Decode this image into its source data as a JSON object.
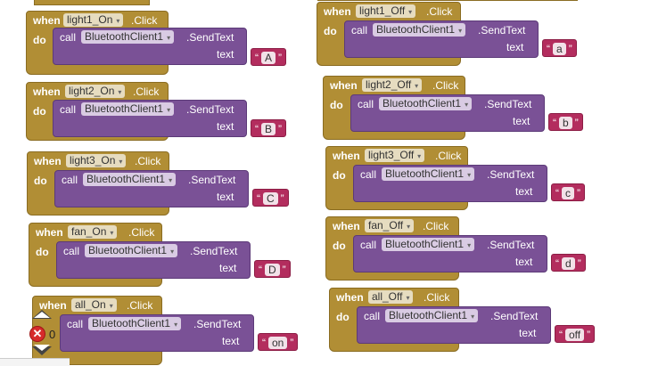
{
  "labels": {
    "when": "when",
    "do": "do",
    "call": "call",
    "text": "text",
    "click": ".Click",
    "send_text": ".SendText",
    "component": "BluetoothClient1"
  },
  "left_blocks": [
    {
      "event": "light1_On",
      "value": "A"
    },
    {
      "event": "light2_On",
      "value": "B"
    },
    {
      "event": "light3_On",
      "value": "C"
    },
    {
      "event": "fan_On",
      "value": "D"
    },
    {
      "event": "all_On",
      "value": "on"
    }
  ],
  "right_blocks": [
    {
      "event": "light1_Off",
      "value": "a"
    },
    {
      "event": "light2_Off",
      "value": "b"
    },
    {
      "event": "light3_Off",
      "value": "c"
    },
    {
      "event": "fan_Off",
      "value": "d"
    },
    {
      "event": "all_Off",
      "value": "off"
    }
  ],
  "controls": {
    "error_count": "0",
    "error_icon": "error-x-icon",
    "nav_up_icon": "arrow-up-icon",
    "nav_down_icon": "arrow-down-icon"
  },
  "colors": {
    "event_block": "#b18e35",
    "call_block": "#7a5196",
    "text_block": "#b32d5e",
    "error": "#d62b2b"
  }
}
